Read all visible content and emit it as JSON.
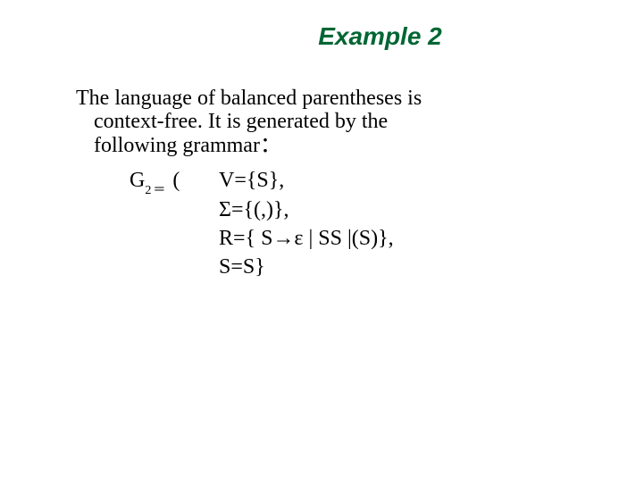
{
  "title": "Example 2",
  "body": {
    "line1": "The language of balanced parentheses is",
    "line2": "context-free. It is generated by the",
    "line3": "following grammar："
  },
  "grammar": {
    "label_G": "G",
    "label_sub": "2",
    "label_eq": "＝",
    "label_openparen": "(",
    "V_label": "V",
    "V_rest": "={S},",
    "Sigma_label": "Σ",
    "Sigma_rest": "={(,)},",
    "R_label": "R",
    "R_rest": "={ S→ε | SS |(S)},",
    "S_label": "S",
    "S_rest": "=S}"
  }
}
